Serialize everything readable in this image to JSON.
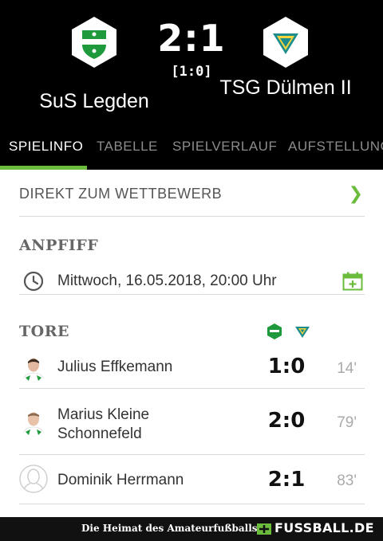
{
  "match": {
    "home_team": "SuS Legden",
    "away_team": "TSG Dülmen II",
    "score": "2:1",
    "halftime": "[1:0]",
    "home_crest": "sus-legden-crest-icon",
    "away_crest": "tsg-duelmen-crest-icon"
  },
  "tabs": [
    {
      "label": "SPIELINFO",
      "active": true
    },
    {
      "label": "TABELLE",
      "active": false
    },
    {
      "label": "SPIELVERLAUF",
      "active": false
    },
    {
      "label": "AUFSTELLUNG",
      "active": false
    }
  ],
  "competition_link": {
    "label": "DIREKT ZUM WETTBEWERB",
    "icon": "chevron-right-icon"
  },
  "kickoff": {
    "title": "ANPFIFF",
    "datetime": "Mittwoch, 16.05.2018, 20:00 Uhr",
    "icon": "clock-icon",
    "action_icon": "calendar-add-icon"
  },
  "goals": {
    "title": "TORE",
    "items": [
      {
        "player": "Julius Effkemann",
        "score": "1:0",
        "minute": "14'",
        "avatar": "player-photo"
      },
      {
        "player": "Marius Kleine Schonnefeld",
        "score": "2:0",
        "minute": "79'",
        "avatar": "player-photo"
      },
      {
        "player": "Dominik Herrmann",
        "score": "2:1",
        "minute": "83'",
        "avatar": "placeholder-avatar"
      }
    ]
  },
  "footer": {
    "slogan": "Die Heimat des Amateurfußballs",
    "brand": "FUSSBALL.DE"
  },
  "colors": {
    "accent": "#6bbb3c",
    "header_bg": "#000000",
    "home_green": "#1e9a3c",
    "away_teal": "#1c8c8c",
    "away_yellow": "#f2d43c"
  }
}
